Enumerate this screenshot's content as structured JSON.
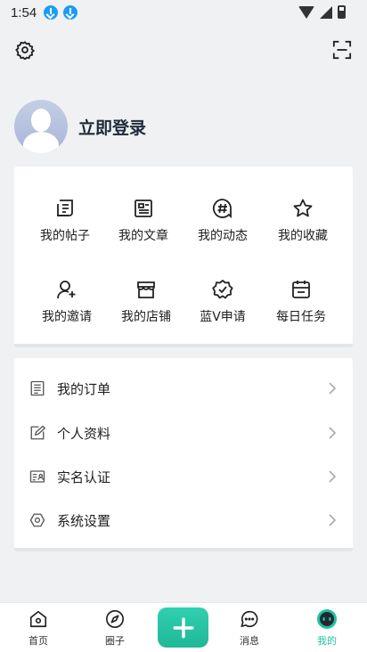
{
  "status_bar": {
    "time": "1:54"
  },
  "profile": {
    "login_label": "立即登录"
  },
  "grid": {
    "items": [
      {
        "label": "我的帖子",
        "icon": "post-icon"
      },
      {
        "label": "我的文章",
        "icon": "article-icon"
      },
      {
        "label": "我的动态",
        "icon": "hashtag-icon"
      },
      {
        "label": "我的收藏",
        "icon": "star-icon"
      },
      {
        "label": "我的邀请",
        "icon": "invite-user-icon"
      },
      {
        "label": "我的店铺",
        "icon": "store-icon"
      },
      {
        "label": "蓝V申请",
        "icon": "verified-badge-icon"
      },
      {
        "label": "每日任务",
        "icon": "calendar-icon"
      }
    ]
  },
  "menu": {
    "items": [
      {
        "label": "我的订单",
        "icon": "order-list-icon"
      },
      {
        "label": "个人资料",
        "icon": "edit-profile-icon"
      },
      {
        "label": "实名认证",
        "icon": "id-card-icon"
      },
      {
        "label": "系统设置",
        "icon": "settings-hex-icon"
      }
    ]
  },
  "bottom_nav": {
    "items": [
      {
        "label": "首页",
        "icon": "home-icon"
      },
      {
        "label": "圈子",
        "icon": "compass-icon"
      },
      {
        "label": "消息",
        "icon": "message-icon"
      },
      {
        "label": "我的",
        "icon": "profile-face-icon",
        "active": true
      }
    ]
  },
  "colors": {
    "accent": "#22c1a0",
    "background": "#f0f1f3",
    "card": "#ffffff"
  }
}
